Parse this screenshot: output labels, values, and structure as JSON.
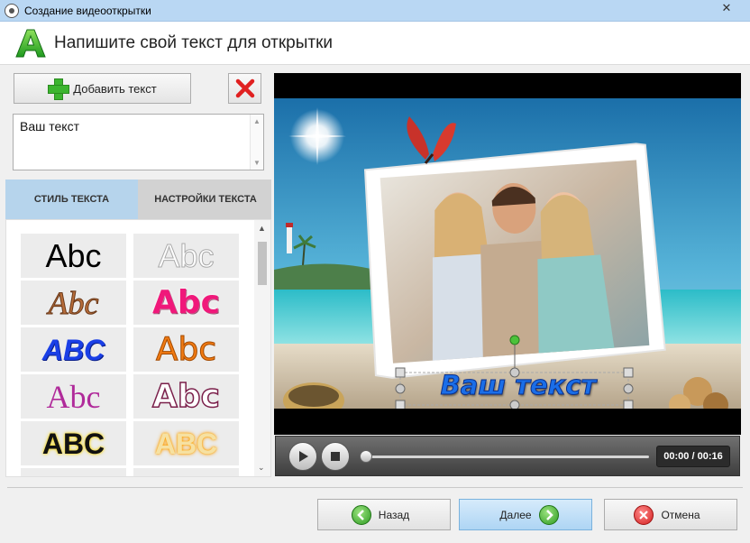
{
  "window": {
    "title": "Создание видеооткрытки",
    "close_glyph": "✕"
  },
  "header": {
    "title": "Напишите свой текст для открытки",
    "logo_letter": "A"
  },
  "left_panel": {
    "add_button_label": "Добавить текст",
    "delete_button_glyph": "✕",
    "text_value": "Ваш текст",
    "tabs": [
      {
        "label": "СТИЛЬ ТЕКСТА",
        "active": true
      },
      {
        "label": "НАСТРОЙКИ ТЕКСТА",
        "active": false
      }
    ],
    "styles": [
      {
        "text": "Abc",
        "color": "#000000"
      },
      {
        "text": "Abc",
        "color": "#ffffff"
      },
      {
        "text": "Abc",
        "color": "#b86d3a"
      },
      {
        "text": "Abc",
        "color": "#f0187a"
      },
      {
        "text": "ABC",
        "color": "#1a3fe6"
      },
      {
        "text": "Abc",
        "color": "#f07a12"
      },
      {
        "text": "Abc",
        "color": "#b02a9a"
      },
      {
        "text": "Abc",
        "color": "#ffffff"
      },
      {
        "text": "ABC",
        "color": "#111111"
      },
      {
        "text": "ABC",
        "color": "#f6e1a2"
      }
    ]
  },
  "preview": {
    "overlay_text": "Ваш текст"
  },
  "player": {
    "time": "00:00 / 00:16",
    "progress": 0.0
  },
  "footer": {
    "back_label": "Назад",
    "next_label": "Далее",
    "cancel_label": "Отмена"
  },
  "colors": {
    "accent": "#b6d4ec",
    "next_button": "#aed5f4",
    "green": "#3cb52f",
    "red": "#d31f1f"
  }
}
